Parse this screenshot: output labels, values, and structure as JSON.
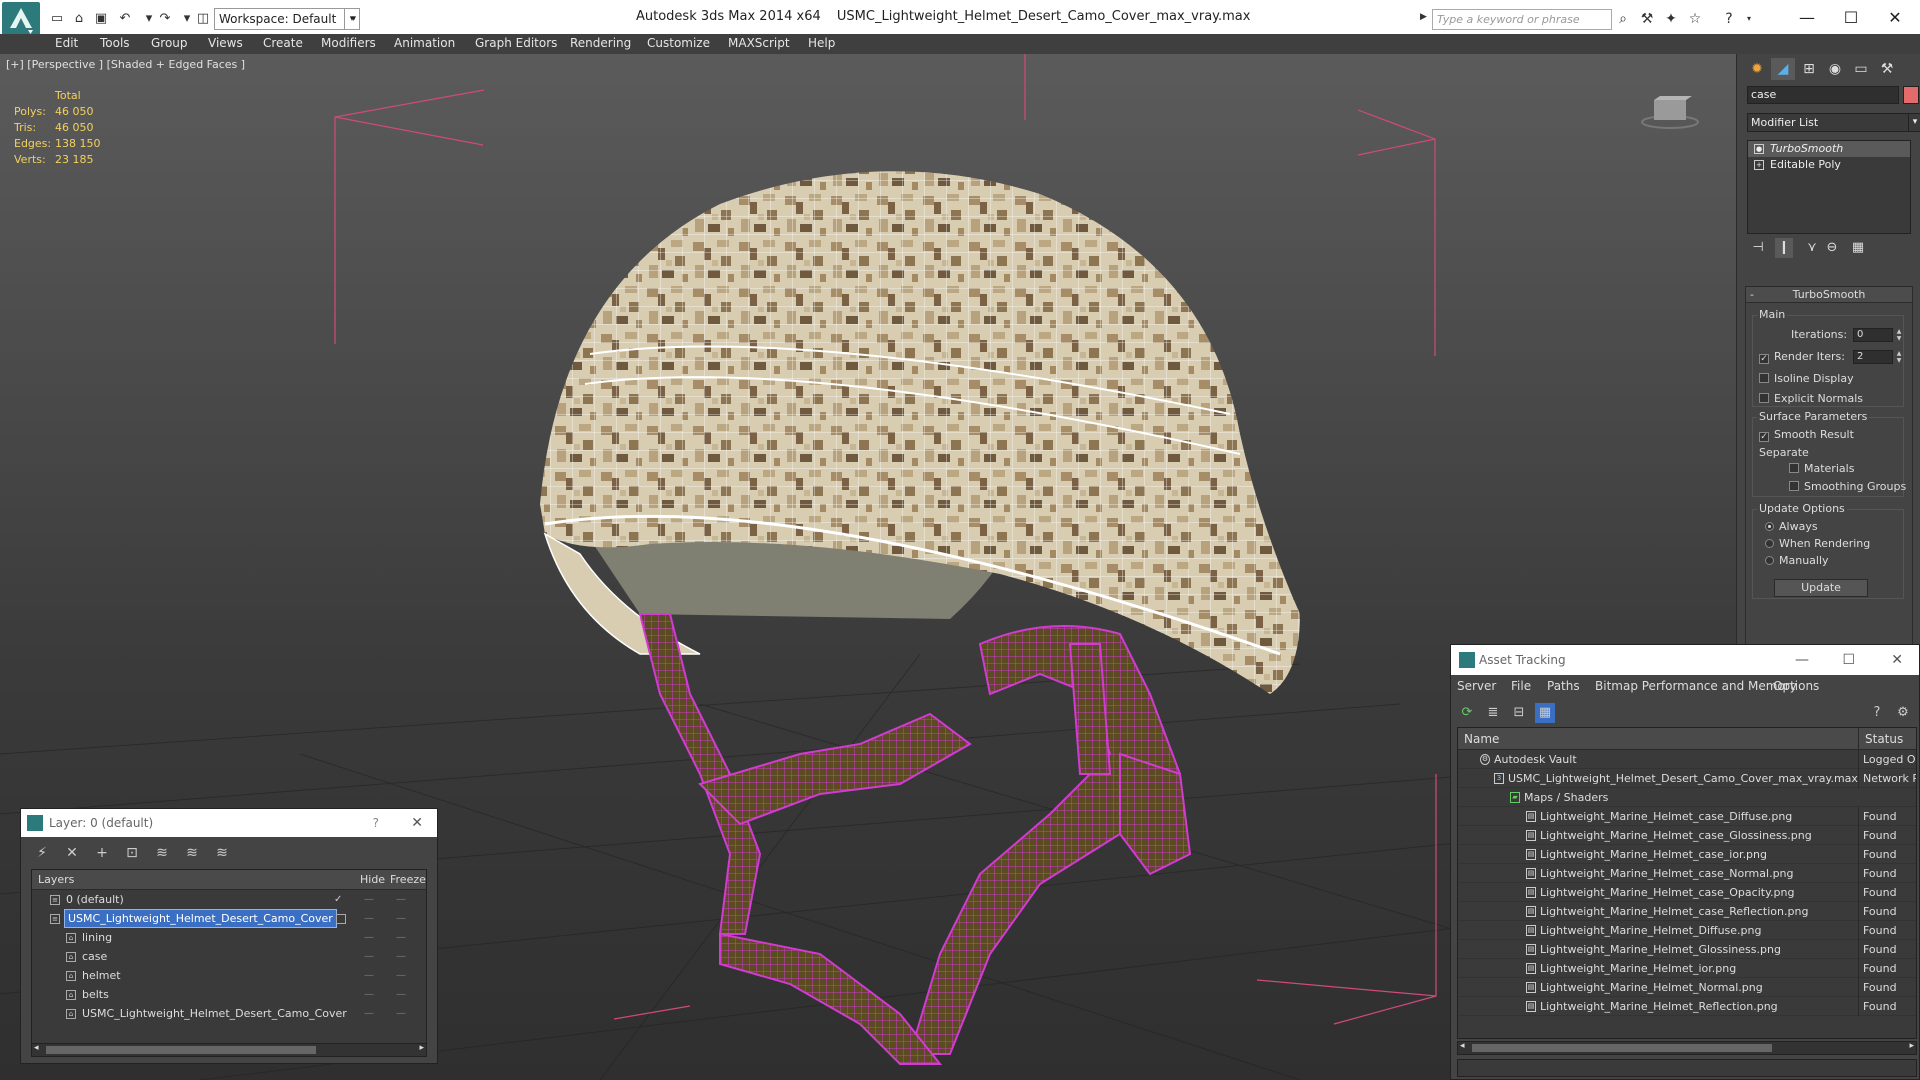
{
  "titlebar": {
    "workspace_label": "Workspace: Default",
    "app_name": "Autodesk 3ds Max  2014 x64",
    "file_name": "USMC_Lightweight_Helmet_Desert_Camo_Cover_max_vray.max",
    "search_placeholder": "Type a keyword or phrase",
    "min_glyph": "—",
    "max_glyph": "☐",
    "close_glyph": "✕"
  },
  "menubar": {
    "items": [
      "Edit",
      "Tools",
      "Group",
      "Views",
      "Create",
      "Modifiers",
      "Animation",
      "Graph Editors",
      "Rendering",
      "Customize",
      "MAXScript",
      "Help"
    ]
  },
  "viewport": {
    "label": "[+] [Perspective ] [Shaded + Edged Faces ]",
    "stats": {
      "total_label": "Total",
      "rows": [
        {
          "label": "Polys:",
          "value": "46 050"
        },
        {
          "label": "Tris:",
          "value": "46 050"
        },
        {
          "label": "Edges:",
          "value": "138 150"
        },
        {
          "label": "Verts:",
          "value": "23 185"
        }
      ]
    },
    "colors": {
      "wireframe": "#ffffff",
      "belts": "#d23bd2",
      "camo_light": "#d9ccb0",
      "camo_mid": "#b39c76",
      "camo_dark": "#7d6543"
    }
  },
  "command_panel": {
    "object_name": "case",
    "object_color": "#e36b6b",
    "modifier_list": "Modifier List",
    "stack": [
      {
        "label": "TurboSmooth",
        "active": true
      },
      {
        "label": "Editable Poly",
        "active": false
      }
    ],
    "rollout": {
      "title": "TurboSmooth",
      "main_group": "Main",
      "iterations_label": "Iterations:",
      "iterations_value": "0",
      "render_iters_label": "Render Iters:",
      "render_iters_value": "2",
      "isoline_label": "Isoline Display",
      "explicit_label": "Explicit Normals",
      "surface_group": "Surface Parameters",
      "smooth_label": "Smooth Result",
      "separate_label": "Separate",
      "materials_label": "Materials",
      "smoothing_groups_label": "Smoothing Groups",
      "update_group": "Update Options",
      "always_label": "Always",
      "when_rendering_label": "When Rendering",
      "manually_label": "Manually",
      "update_button": "Update"
    }
  },
  "layer_dialog": {
    "title": "Layer: 0 (default)",
    "help": "?",
    "close": "✕",
    "columns": {
      "layers": "Layers",
      "hide": "Hide",
      "freeze": "Freeze"
    },
    "rows": [
      {
        "name": "0 (default)",
        "level": 0,
        "selected": false,
        "current": true
      },
      {
        "name": "USMC_Lightweight_Helmet_Desert_Camo_Cover",
        "level": 0,
        "selected": true,
        "current": false
      },
      {
        "name": "lining",
        "level": 1,
        "selected": false,
        "current": false
      },
      {
        "name": "case",
        "level": 1,
        "selected": false,
        "current": false
      },
      {
        "name": "helmet",
        "level": 1,
        "selected": false,
        "current": false
      },
      {
        "name": "belts",
        "level": 1,
        "selected": false,
        "current": false
      },
      {
        "name": "USMC_Lightweight_Helmet_Desert_Camo_Cover",
        "level": 1,
        "selected": false,
        "current": false
      }
    ]
  },
  "asset_dialog": {
    "title": "Asset Tracking",
    "menu": [
      "Server",
      "File",
      "Paths",
      "Bitmap Performance and Memory",
      "Options"
    ],
    "columns": {
      "name": "Name",
      "status": "Status"
    },
    "rows": [
      {
        "name": "Autodesk Vault",
        "status": "Logged Out",
        "level": 1
      },
      {
        "name": "USMC_Lightweight_Helmet_Desert_Camo_Cover_max_vray.max",
        "status": "Network Path",
        "level": 2
      },
      {
        "name": "Maps / Shaders",
        "status": "",
        "level": 3
      },
      {
        "name": "Lightweight_Marine_Helmet_case_Diffuse.png",
        "status": "Found",
        "level": 4
      },
      {
        "name": "Lightweight_Marine_Helmet_case_Glossiness.png",
        "status": "Found",
        "level": 4
      },
      {
        "name": "Lightweight_Marine_Helmet_case_ior.png",
        "status": "Found",
        "level": 4
      },
      {
        "name": "Lightweight_Marine_Helmet_case_Normal.png",
        "status": "Found",
        "level": 4
      },
      {
        "name": "Lightweight_Marine_Helmet_case_Opacity.png",
        "status": "Found",
        "level": 4
      },
      {
        "name": "Lightweight_Marine_Helmet_case_Reflection.png",
        "status": "Found",
        "level": 4
      },
      {
        "name": "Lightweight_Marine_Helmet_Diffuse.png",
        "status": "Found",
        "level": 4
      },
      {
        "name": "Lightweight_Marine_Helmet_Glossiness.png",
        "status": "Found",
        "level": 4
      },
      {
        "name": "Lightweight_Marine_Helmet_ior.png",
        "status": "Found",
        "level": 4
      },
      {
        "name": "Lightweight_Marine_Helmet_Normal.png",
        "status": "Found",
        "level": 4
      },
      {
        "name": "Lightweight_Marine_Helmet_Reflection.png",
        "status": "Found",
        "level": 4
      }
    ]
  }
}
